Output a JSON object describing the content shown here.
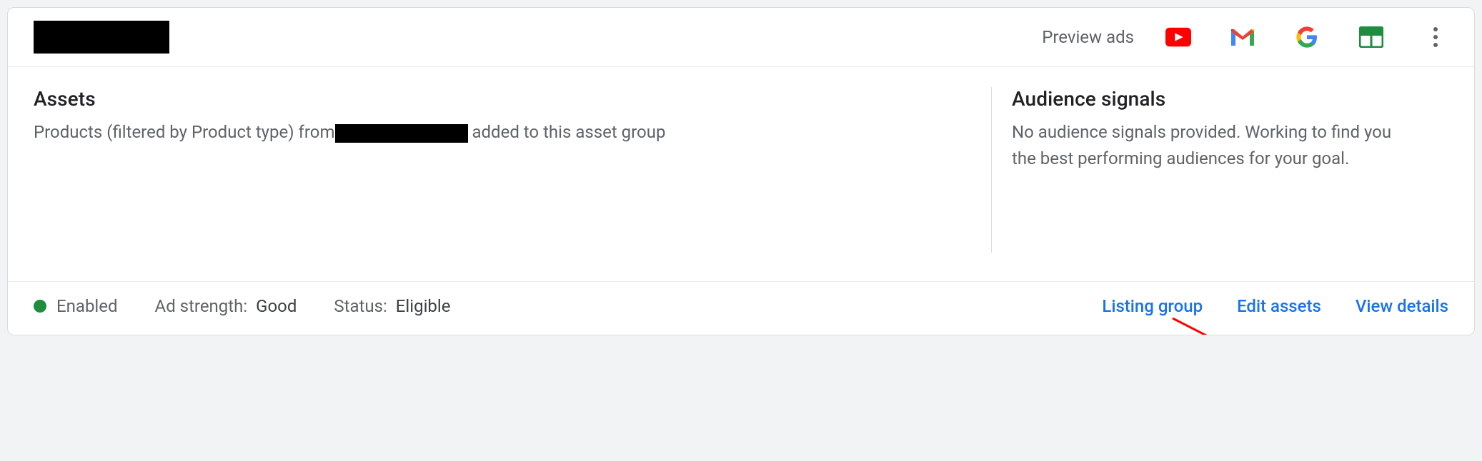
{
  "header": {
    "preview_label": "Preview ads"
  },
  "assets": {
    "title": "Assets",
    "desc_prefix": "Products (filtered by Product type) from",
    "desc_suffix": " added to this asset group"
  },
  "audience": {
    "title": "Audience signals",
    "desc": "No audience signals provided. Working to find you the best performing audiences for your goal."
  },
  "footer": {
    "enabled_label": "Enabled",
    "ad_strength_label": "Ad strength:",
    "ad_strength_value": "Good",
    "status_label": "Status:",
    "status_value": "Eligible",
    "listing_group": "Listing group",
    "edit_assets": "Edit assets",
    "view_details": "View details"
  }
}
